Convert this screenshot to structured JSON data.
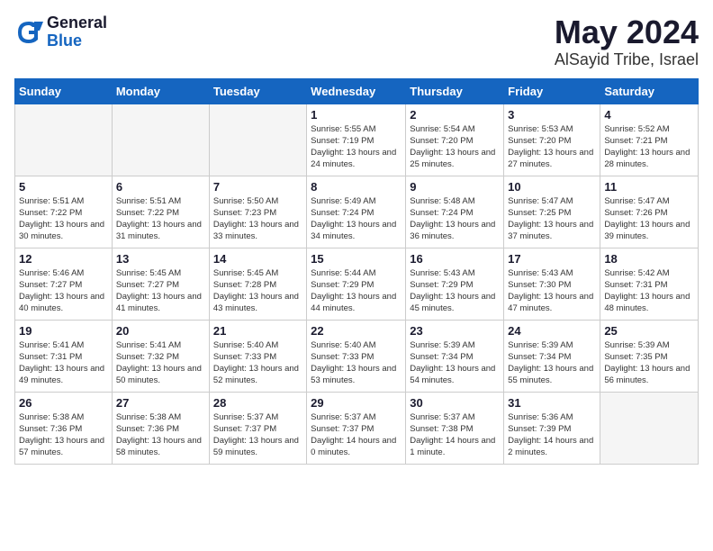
{
  "header": {
    "logo_general": "General",
    "logo_blue": "Blue",
    "month": "May 2024",
    "location": "AlSayid Tribe, Israel"
  },
  "weekdays": [
    "Sunday",
    "Monday",
    "Tuesday",
    "Wednesday",
    "Thursday",
    "Friday",
    "Saturday"
  ],
  "weeks": [
    [
      {
        "day": "",
        "info": ""
      },
      {
        "day": "",
        "info": ""
      },
      {
        "day": "",
        "info": ""
      },
      {
        "day": "1",
        "info": "Sunrise: 5:55 AM\nSunset: 7:19 PM\nDaylight: 13 hours\nand 24 minutes."
      },
      {
        "day": "2",
        "info": "Sunrise: 5:54 AM\nSunset: 7:20 PM\nDaylight: 13 hours\nand 25 minutes."
      },
      {
        "day": "3",
        "info": "Sunrise: 5:53 AM\nSunset: 7:20 PM\nDaylight: 13 hours\nand 27 minutes."
      },
      {
        "day": "4",
        "info": "Sunrise: 5:52 AM\nSunset: 7:21 PM\nDaylight: 13 hours\nand 28 minutes."
      }
    ],
    [
      {
        "day": "5",
        "info": "Sunrise: 5:51 AM\nSunset: 7:22 PM\nDaylight: 13 hours\nand 30 minutes."
      },
      {
        "day": "6",
        "info": "Sunrise: 5:51 AM\nSunset: 7:22 PM\nDaylight: 13 hours\nand 31 minutes."
      },
      {
        "day": "7",
        "info": "Sunrise: 5:50 AM\nSunset: 7:23 PM\nDaylight: 13 hours\nand 33 minutes."
      },
      {
        "day": "8",
        "info": "Sunrise: 5:49 AM\nSunset: 7:24 PM\nDaylight: 13 hours\nand 34 minutes."
      },
      {
        "day": "9",
        "info": "Sunrise: 5:48 AM\nSunset: 7:24 PM\nDaylight: 13 hours\nand 36 minutes."
      },
      {
        "day": "10",
        "info": "Sunrise: 5:47 AM\nSunset: 7:25 PM\nDaylight: 13 hours\nand 37 minutes."
      },
      {
        "day": "11",
        "info": "Sunrise: 5:47 AM\nSunset: 7:26 PM\nDaylight: 13 hours\nand 39 minutes."
      }
    ],
    [
      {
        "day": "12",
        "info": "Sunrise: 5:46 AM\nSunset: 7:27 PM\nDaylight: 13 hours\nand 40 minutes."
      },
      {
        "day": "13",
        "info": "Sunrise: 5:45 AM\nSunset: 7:27 PM\nDaylight: 13 hours\nand 41 minutes."
      },
      {
        "day": "14",
        "info": "Sunrise: 5:45 AM\nSunset: 7:28 PM\nDaylight: 13 hours\nand 43 minutes."
      },
      {
        "day": "15",
        "info": "Sunrise: 5:44 AM\nSunset: 7:29 PM\nDaylight: 13 hours\nand 44 minutes."
      },
      {
        "day": "16",
        "info": "Sunrise: 5:43 AM\nSunset: 7:29 PM\nDaylight: 13 hours\nand 45 minutes."
      },
      {
        "day": "17",
        "info": "Sunrise: 5:43 AM\nSunset: 7:30 PM\nDaylight: 13 hours\nand 47 minutes."
      },
      {
        "day": "18",
        "info": "Sunrise: 5:42 AM\nSunset: 7:31 PM\nDaylight: 13 hours\nand 48 minutes."
      }
    ],
    [
      {
        "day": "19",
        "info": "Sunrise: 5:41 AM\nSunset: 7:31 PM\nDaylight: 13 hours\nand 49 minutes."
      },
      {
        "day": "20",
        "info": "Sunrise: 5:41 AM\nSunset: 7:32 PM\nDaylight: 13 hours\nand 50 minutes."
      },
      {
        "day": "21",
        "info": "Sunrise: 5:40 AM\nSunset: 7:33 PM\nDaylight: 13 hours\nand 52 minutes."
      },
      {
        "day": "22",
        "info": "Sunrise: 5:40 AM\nSunset: 7:33 PM\nDaylight: 13 hours\nand 53 minutes."
      },
      {
        "day": "23",
        "info": "Sunrise: 5:39 AM\nSunset: 7:34 PM\nDaylight: 13 hours\nand 54 minutes."
      },
      {
        "day": "24",
        "info": "Sunrise: 5:39 AM\nSunset: 7:34 PM\nDaylight: 13 hours\nand 55 minutes."
      },
      {
        "day": "25",
        "info": "Sunrise: 5:39 AM\nSunset: 7:35 PM\nDaylight: 13 hours\nand 56 minutes."
      }
    ],
    [
      {
        "day": "26",
        "info": "Sunrise: 5:38 AM\nSunset: 7:36 PM\nDaylight: 13 hours\nand 57 minutes."
      },
      {
        "day": "27",
        "info": "Sunrise: 5:38 AM\nSunset: 7:36 PM\nDaylight: 13 hours\nand 58 minutes."
      },
      {
        "day": "28",
        "info": "Sunrise: 5:37 AM\nSunset: 7:37 PM\nDaylight: 13 hours\nand 59 minutes."
      },
      {
        "day": "29",
        "info": "Sunrise: 5:37 AM\nSunset: 7:37 PM\nDaylight: 14 hours\nand 0 minutes."
      },
      {
        "day": "30",
        "info": "Sunrise: 5:37 AM\nSunset: 7:38 PM\nDaylight: 14 hours\nand 1 minute."
      },
      {
        "day": "31",
        "info": "Sunrise: 5:36 AM\nSunset: 7:39 PM\nDaylight: 14 hours\nand 2 minutes."
      },
      {
        "day": "",
        "info": ""
      }
    ]
  ]
}
